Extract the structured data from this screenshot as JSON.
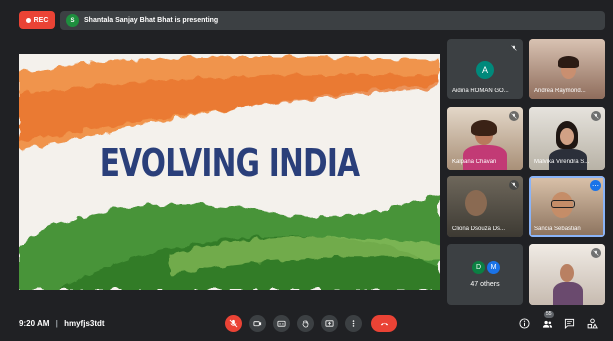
{
  "recording": {
    "label": "REC"
  },
  "presenter_bar": {
    "avatar_initial": "S",
    "text": "Shantala Sanjay Bhat Bhat is presenting"
  },
  "slide": {
    "title": "EVOLVING INDIA"
  },
  "participants": [
    {
      "name": "Aidina ROMAN GO...",
      "avatar_initial": "A",
      "avatar_color": "#00897b",
      "muted": true
    },
    {
      "name": "Andrea Raymond...",
      "muted": false
    },
    {
      "name": "Kalpana Chavan",
      "muted": true
    },
    {
      "name": "Malvika Virendra S...",
      "muted": true
    },
    {
      "name": "Cliona Dsouza Ds...",
      "muted": true
    },
    {
      "name": "Sancia Sebastian",
      "muted": false,
      "active_speaker": true
    },
    {
      "name": "",
      "muted": true
    }
  ],
  "others_tile": {
    "initials": [
      "D",
      "M"
    ],
    "label": "47 others"
  },
  "footer": {
    "time": "9:20 AM",
    "separator": "|",
    "meeting_code": "hmyfjs3tdt",
    "participant_count": "55"
  },
  "colors": {
    "record_red": "#ea4335",
    "background": "#202124",
    "tile_bg": "#3c4043",
    "active_border": "#8ab4f8"
  }
}
